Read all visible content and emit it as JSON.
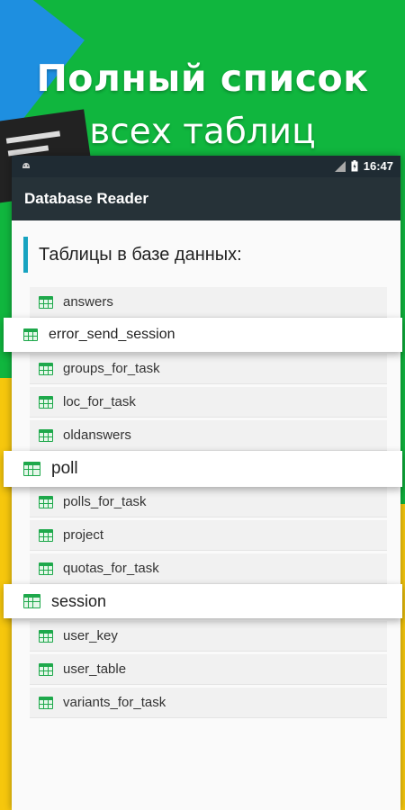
{
  "headline": {
    "line1": "Полный список",
    "line2": "всех таблиц"
  },
  "status": {
    "time": "16:47"
  },
  "app": {
    "title": "Database Reader"
  },
  "section": {
    "title": "Таблицы в базе данных:"
  },
  "tables": [
    "answers",
    "error_send_session",
    "groups_for_task",
    "loc_for_task",
    "oldanswers",
    "poll",
    "polls_for_task",
    "project",
    "quotas_for_task",
    "session",
    "user_key",
    "user_table",
    "variants_for_task"
  ],
  "colors": {
    "background_green": "#10b63e",
    "appbar": "#263238",
    "accent": "#17a3c0",
    "table_icon": "#1ea84b"
  }
}
